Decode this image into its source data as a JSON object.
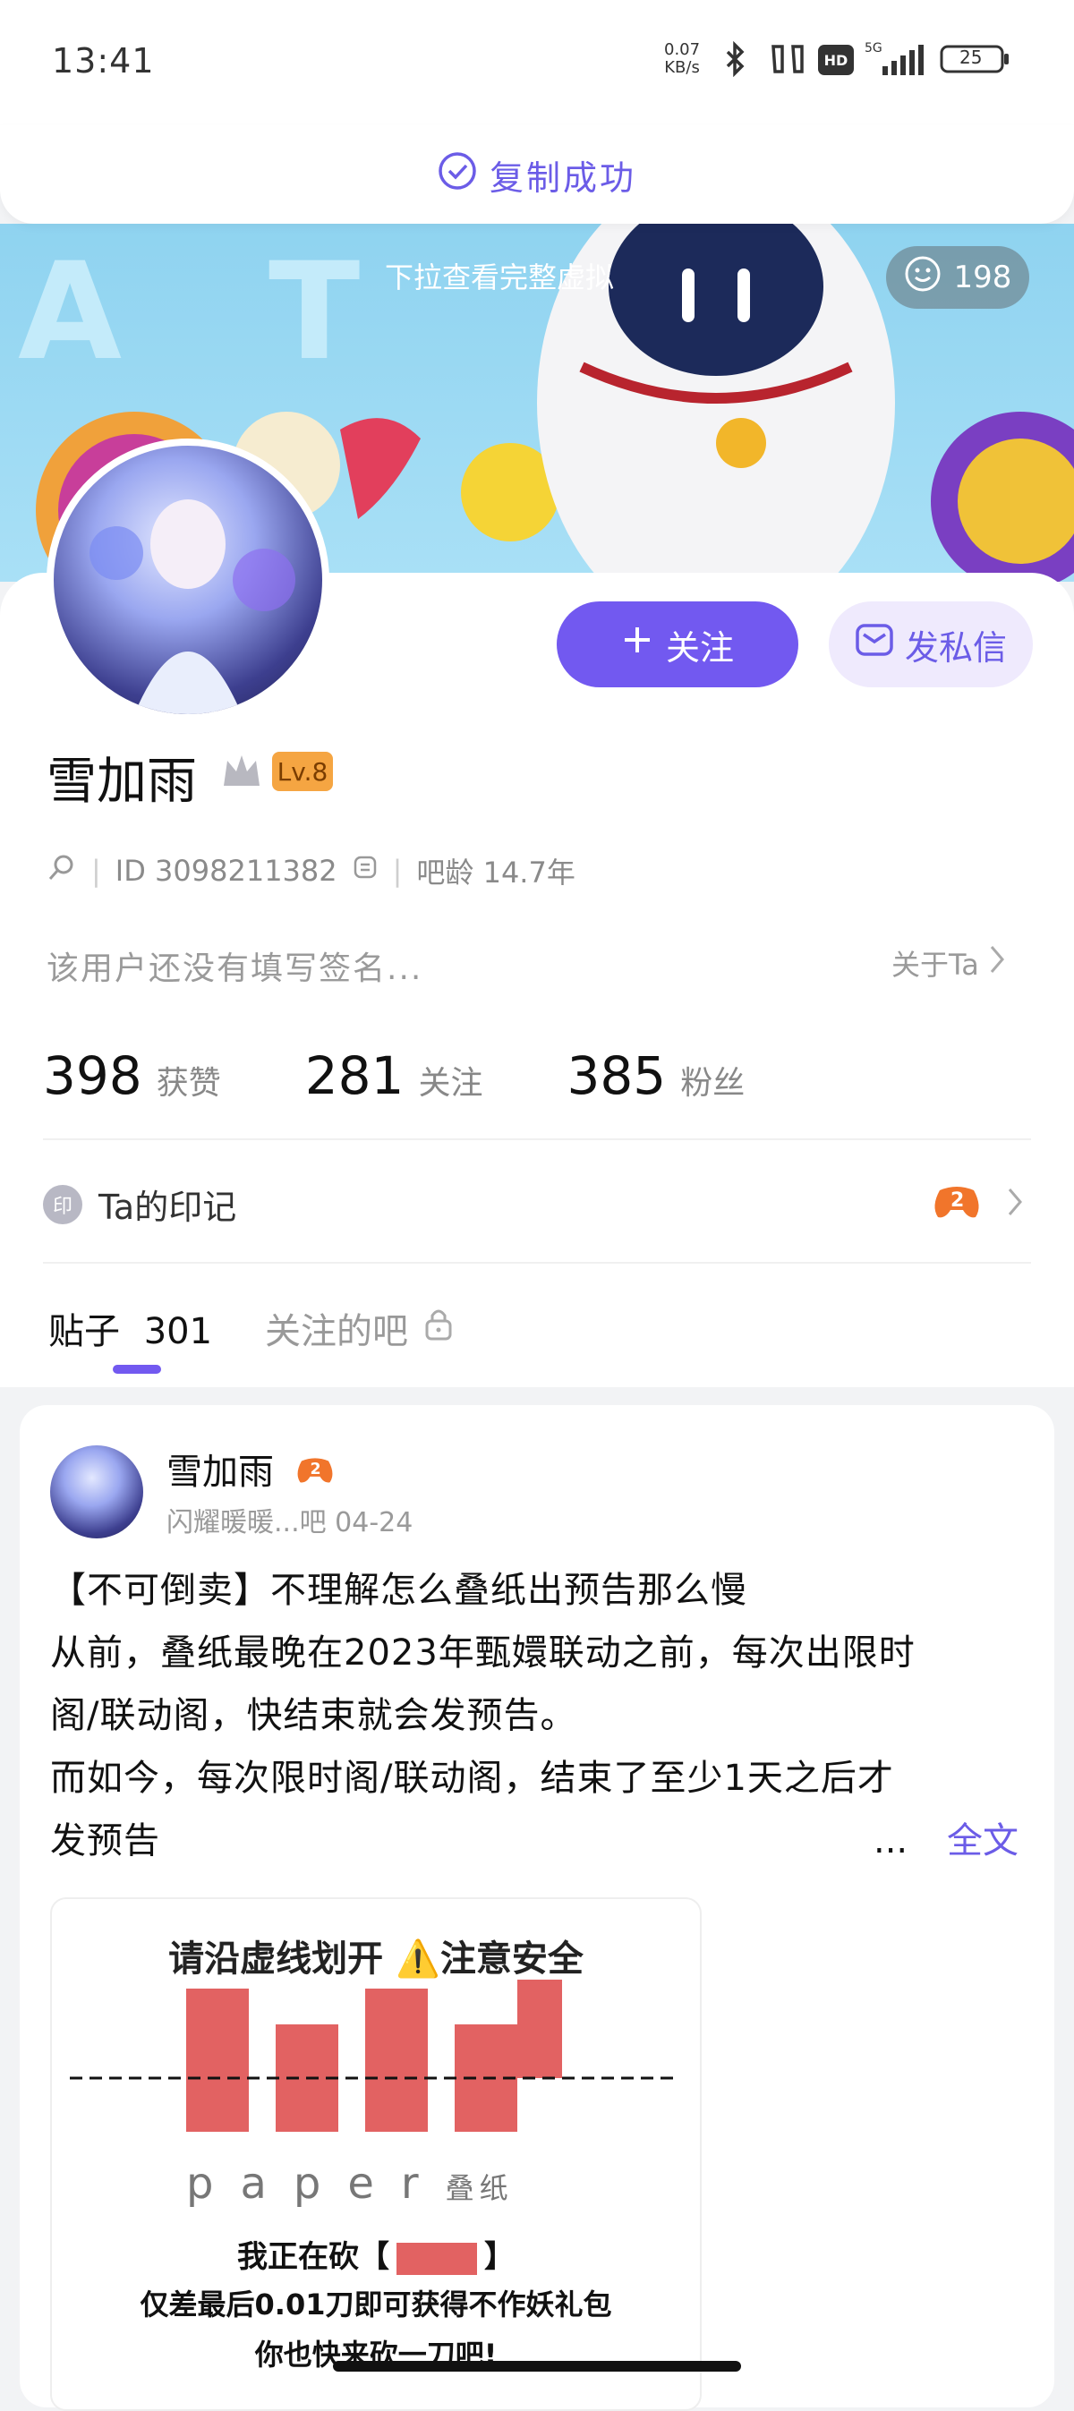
{
  "status_bar": {
    "time": "13:41",
    "net_speed_value": "0.07",
    "net_speed_unit": "KB/s",
    "hd": "HD",
    "signal_label": "5G",
    "battery": "25"
  },
  "toast": {
    "text": "复制成功"
  },
  "banner": {
    "hint": "下拉查看完整虚拟",
    "visits": "198"
  },
  "profile": {
    "follow_label": "关注",
    "message_label": "发私信",
    "username": "雪加雨",
    "level": "Lv.8",
    "id_text": "ID 3098211382",
    "age_text": "吧龄 14.7年",
    "signature": "该用户还没有填写签名...",
    "about_label": "关于Ta"
  },
  "stats": [
    {
      "value": "398",
      "label": "获赞"
    },
    {
      "value": "281",
      "label": "关注"
    },
    {
      "value": "385",
      "label": "粉丝"
    }
  ],
  "marks": {
    "icon_text": "印",
    "label": "Ta的印记"
  },
  "tabs": [
    {
      "label": "贴子",
      "count": "301"
    },
    {
      "label": "关注的吧"
    }
  ],
  "post": {
    "author": "雪加雨",
    "meta": "闪耀暖暖...吧  04-24",
    "title": "【不可倒卖】不理解怎么叠纸出预告那么慢",
    "lines": [
      "从前，叠纸最晚在2023年甄嬛联动之前，每次出限时",
      "阁/联动阁，快结束就会发预告。",
      "而如今，每次限时阁/联动阁，结束了至少1天之后才",
      "发预告"
    ],
    "more": "...",
    "full_text_label": "全文",
    "image": {
      "line1": "请沿虚线划开 ⚠️注意安全",
      "brand_text": "paper",
      "brand_sub": "叠纸",
      "line2": "我正在砍【",
      "line2_end": "】",
      "line3": "仅差最后0.01刀即可获得不作妖礼包",
      "line4": "你也快来砍一刀吧!"
    }
  }
}
